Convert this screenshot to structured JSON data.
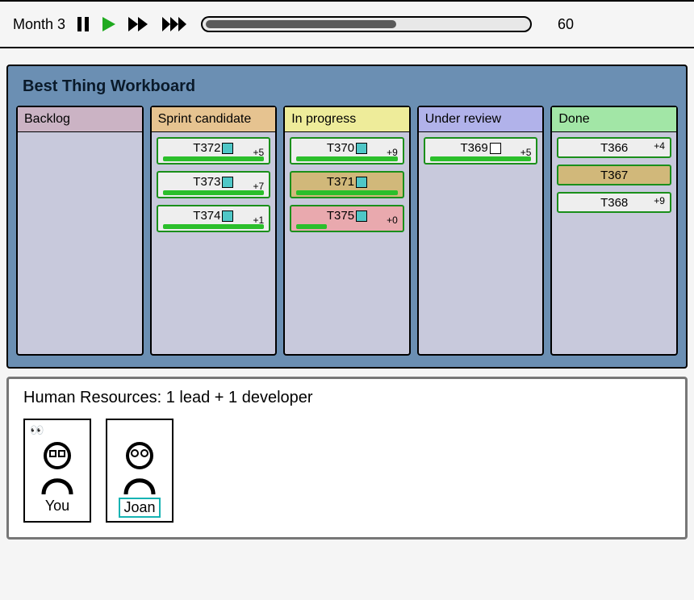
{
  "topbar": {
    "month_label": "Month 3",
    "day": "60",
    "progress_pct": 58
  },
  "board": {
    "title": "Best Thing Workboard",
    "columns": [
      {
        "name": "Backlog",
        "header_bg": "#cbb3c4",
        "cards": []
      },
      {
        "name": "Sprint candidate",
        "header_bg": "#e6c390",
        "cards": [
          {
            "id": "T372",
            "avatar": "cyan",
            "score": "+5",
            "bar_pct": 100,
            "bg": "normal"
          },
          {
            "id": "T373",
            "avatar": "cyan",
            "score": "+7",
            "bar_pct": 100,
            "bg": "normal"
          },
          {
            "id": "T374",
            "avatar": "cyan",
            "score": "+1",
            "bar_pct": 100,
            "bg": "normal"
          }
        ]
      },
      {
        "name": "In progress",
        "header_bg": "#eeec9a",
        "cards": [
          {
            "id": "T370",
            "avatar": "cyan",
            "score": "+9",
            "bar_pct": 100,
            "bg": "normal"
          },
          {
            "id": "T371",
            "avatar": "cyan",
            "score": "",
            "bar_pct": 100,
            "bg": "brown"
          },
          {
            "id": "T375",
            "avatar": "cyan",
            "score": "+0",
            "bar_pct": 30,
            "bg": "pink"
          }
        ]
      },
      {
        "name": "Under review",
        "header_bg": "#b1b2ea",
        "cards": [
          {
            "id": "T369",
            "avatar": "white",
            "score": "+5",
            "bar_pct": 100,
            "bg": "normal"
          }
        ]
      },
      {
        "name": "Done",
        "header_bg": "#a2e6a6",
        "cards": [
          {
            "id": "T366",
            "avatar": "",
            "score": "+4",
            "bar_pct": 0,
            "bg": "normal"
          },
          {
            "id": "T367",
            "avatar": "",
            "score": "",
            "bar_pct": 0,
            "bg": "plain-brown"
          },
          {
            "id": "T368",
            "avatar": "",
            "score": "+9",
            "bar_pct": 0,
            "bg": "normal"
          }
        ]
      }
    ]
  },
  "hr": {
    "title": "Human Resources: 1 lead + 1 developer",
    "people": [
      {
        "name": "You",
        "is_lead": true,
        "highlight": false
      },
      {
        "name": "Joan",
        "is_lead": false,
        "highlight": true
      }
    ]
  }
}
